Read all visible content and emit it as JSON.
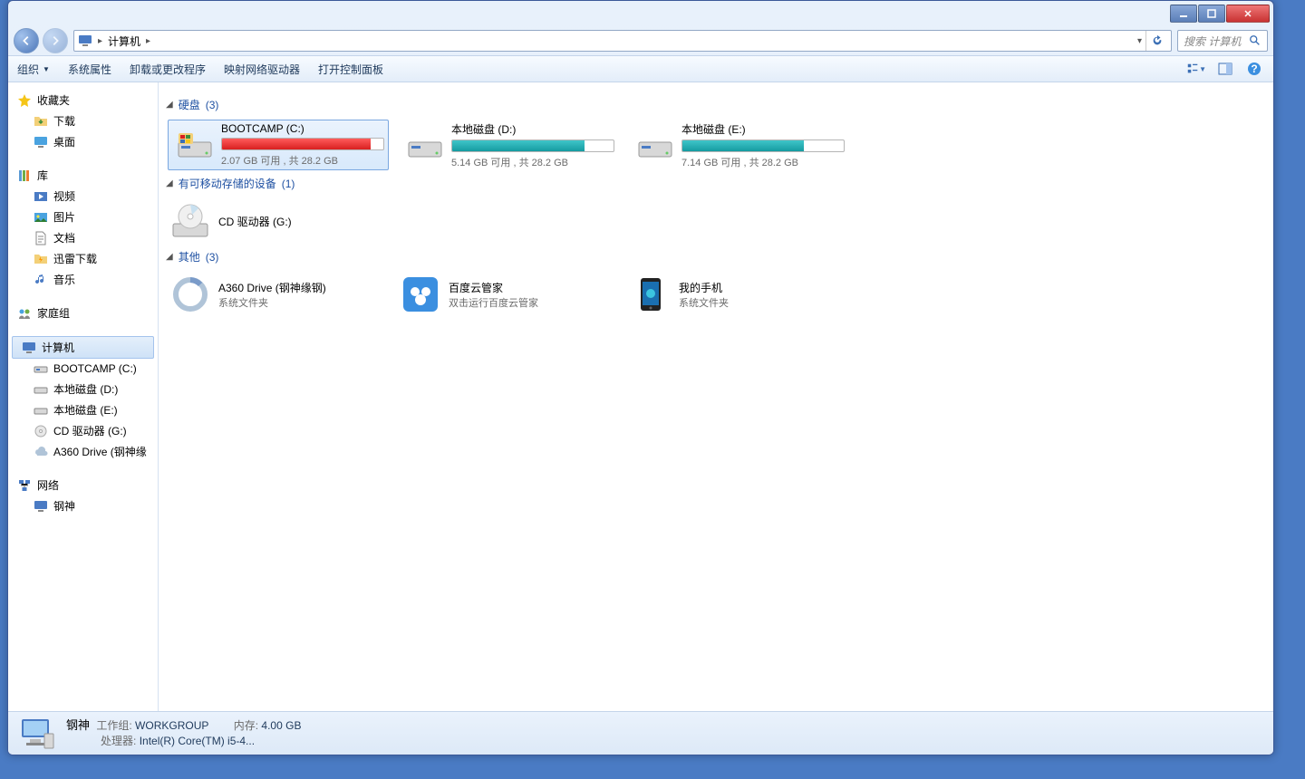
{
  "window": {
    "title": "计算机"
  },
  "nav": {
    "location": "计算机",
    "search_placeholder": "搜索 计算机"
  },
  "toolbar": {
    "organize": "组织",
    "system_properties": "系统属性",
    "uninstall": "卸载或更改程序",
    "map_drive": "映射网络驱动器",
    "control_panel": "打开控制面板"
  },
  "sidebar": {
    "favorites": {
      "label": "收藏夹",
      "items": [
        "下载",
        "桌面"
      ]
    },
    "libraries": {
      "label": "库",
      "items": [
        "视频",
        "图片",
        "文档",
        "迅雷下载",
        "音乐"
      ]
    },
    "homegroup": {
      "label": "家庭组"
    },
    "computer": {
      "label": "计算机",
      "items": [
        "BOOTCAMP (C:)",
        "本地磁盘 (D:)",
        "本地磁盘 (E:)",
        "CD 驱动器 (G:)",
        "A360 Drive (钢神缘"
      ]
    },
    "network": {
      "label": "网络",
      "items": [
        "钢神"
      ]
    }
  },
  "groups": {
    "hdd": {
      "label": "硬盘",
      "count": "(3)"
    },
    "removable": {
      "label": "有可移动存储的设备",
      "count": "(1)"
    },
    "other": {
      "label": "其他",
      "count": "(3)"
    }
  },
  "drives": [
    {
      "name": "BOOTCAMP (C:)",
      "status": "2.07 GB 可用 , 共 28.2 GB",
      "fill": 92,
      "color": "red",
      "selected": true
    },
    {
      "name": "本地磁盘 (D:)",
      "status": "5.14 GB 可用 , 共 28.2 GB",
      "fill": 82,
      "color": "teal",
      "selected": false
    },
    {
      "name": "本地磁盘 (E:)",
      "status": "7.14 GB 可用 , 共 28.2 GB",
      "fill": 75,
      "color": "teal",
      "selected": false
    }
  ],
  "removable": [
    {
      "name": "CD 驱动器 (G:)"
    }
  ],
  "other": [
    {
      "name": "A360 Drive (钢神缘钢)",
      "sub": "系统文件夹",
      "icon": "a360"
    },
    {
      "name": "百度云管家",
      "sub": "双击运行百度云管家",
      "icon": "baidu"
    },
    {
      "name": "我的手机",
      "sub": "系统文件夹",
      "icon": "phone"
    }
  ],
  "details": {
    "name": "钢神",
    "workgroup_label": "工作组:",
    "workgroup": "WORKGROUP",
    "memory_label": "内存:",
    "memory": "4.00 GB",
    "cpu_label": "处理器:",
    "cpu": "Intel(R) Core(TM) i5-4..."
  }
}
